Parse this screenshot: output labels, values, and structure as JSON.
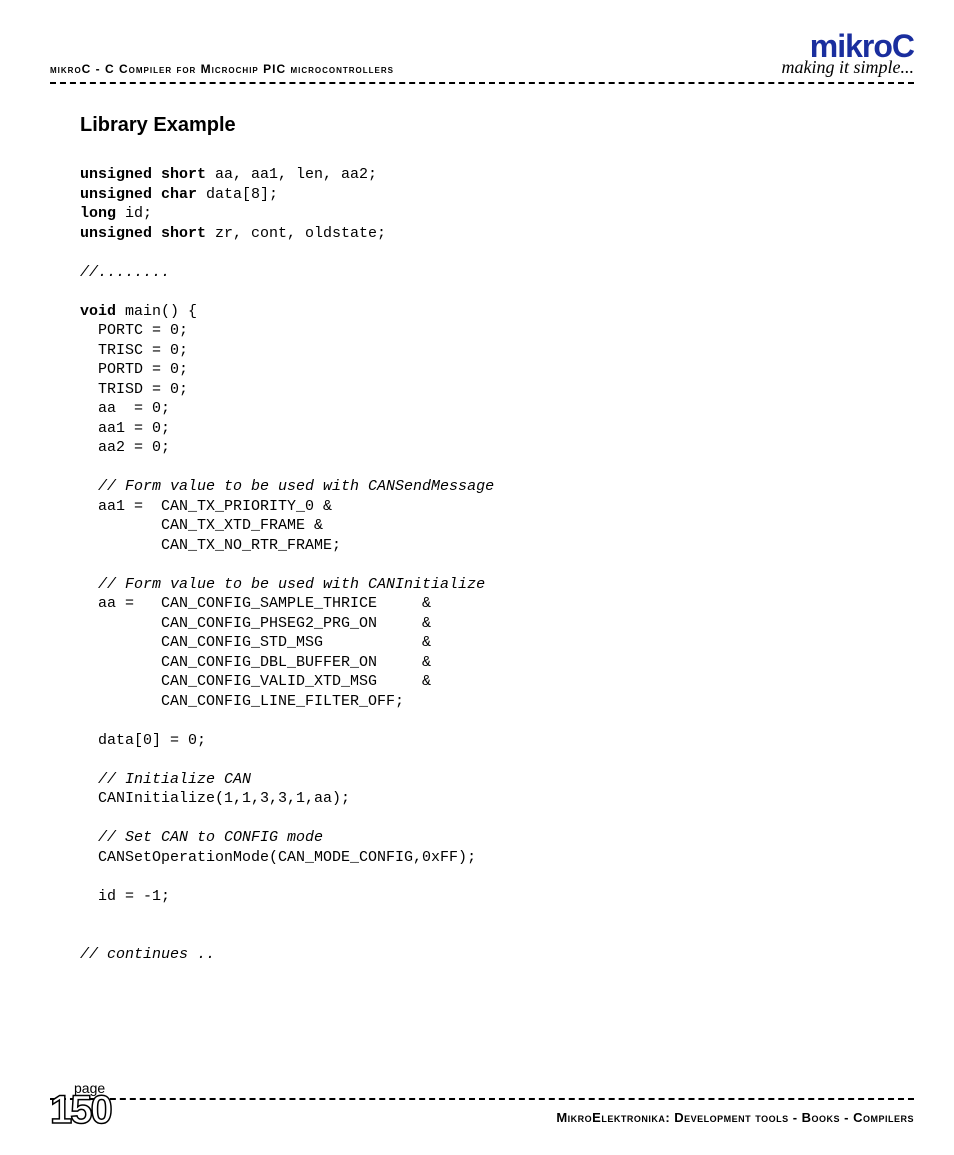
{
  "header": {
    "left": "mikroC - C Compiler for Microchip PIC microcontrollers",
    "logo": "mikroC",
    "tagline": "making it simple..."
  },
  "section_title": "Library Example",
  "code": {
    "l1a": "unsigned short",
    "l1b": " aa, aa1, len, aa2;",
    "l2a": "unsigned char",
    "l2b": " data[8];",
    "l3a": "long",
    "l3b": " id;",
    "l4a": "unsigned short",
    "l4b": " zr, cont, oldstate;",
    "l5": "//........",
    "l6a": "void",
    "l6b": " main() {",
    "l7": "  PORTC = 0;",
    "l8": "  TRISC = 0;",
    "l9": "  PORTD = 0;",
    "l10": "  TRISD = 0;",
    "l11": "  aa  = 0;",
    "l12": "  aa1 = 0;",
    "l13": "  aa2 = 0;",
    "l14": "  // Form value to be used with CANSendMessage",
    "l15": "  aa1 =  CAN_TX_PRIORITY_0 &",
    "l16": "         CAN_TX_XTD_FRAME &",
    "l17": "         CAN_TX_NO_RTR_FRAME;",
    "l18": "  // Form value to be used with CANInitialize",
    "l19": "  aa =   CAN_CONFIG_SAMPLE_THRICE     &",
    "l20": "         CAN_CONFIG_PHSEG2_PRG_ON     &",
    "l21": "         CAN_CONFIG_STD_MSG           &",
    "l22": "         CAN_CONFIG_DBL_BUFFER_ON     &",
    "l23": "         CAN_CONFIG_VALID_XTD_MSG     &",
    "l24": "         CAN_CONFIG_LINE_FILTER_OFF;",
    "l25": "  data[0] = 0;",
    "l26": "  // Initialize CAN",
    "l27": "  CANInitialize(1,1,3,3,1,aa);",
    "l28": "  // Set CAN to CONFIG mode",
    "l29": "  CANSetOperationMode(CAN_MODE_CONFIG,0xFF);",
    "l30": "  id = -1;",
    "l31": "// continues .."
  },
  "footer": {
    "page_label": "page",
    "page_number": "150",
    "text": "MikroElektronika: Development tools - Books - Compilers"
  }
}
